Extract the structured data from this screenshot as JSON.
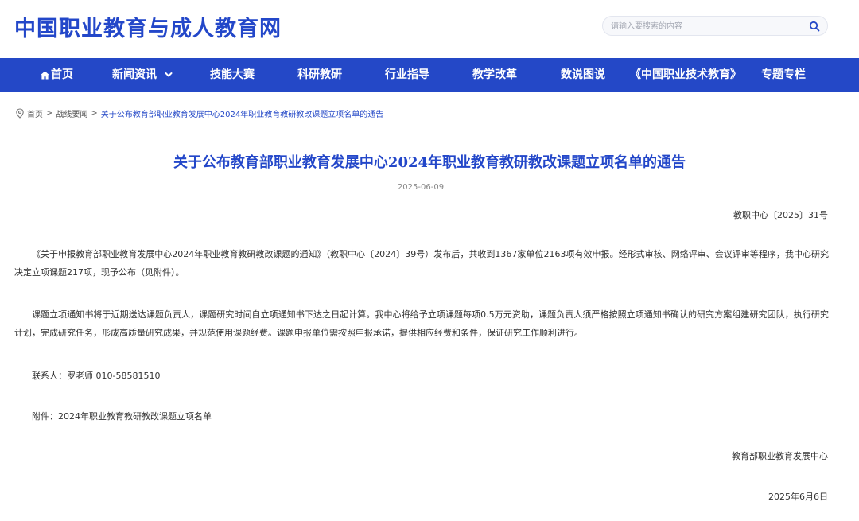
{
  "header": {
    "site_title": "中国职业教育与成人教育网",
    "search_placeholder": "请输入要搜索的内容"
  },
  "nav": {
    "items": [
      {
        "label": "首页",
        "icon": "home-icon"
      },
      {
        "label": "新闻资讯",
        "icon": "chevron-down-icon"
      },
      {
        "label": "技能大赛"
      },
      {
        "label": "科研教研"
      },
      {
        "label": "行业指导"
      },
      {
        "label": "教学改革"
      },
      {
        "label": "数说图说"
      },
      {
        "label": "《中国职业技术教育》"
      },
      {
        "label": "专题专栏"
      }
    ]
  },
  "breadcrumb": {
    "icon": "location-pin-icon",
    "items": [
      "首页",
      "战线要闻",
      "关于公布教育部职业教育发展中心2024年职业教育教研教改课题立项名单的通告"
    ],
    "separator": ">"
  },
  "article": {
    "title": "关于公布教育部职业教育发展中心2024年职业教育教研教改课题立项名单的通告",
    "date": "2025-06-09",
    "doc_no": "教职中心〔2025〕31号",
    "paragraphs": [
      "《关于申报教育部职业教育发展中心2024年职业教育教研教改课题的通知》（教职中心〔2024〕39号）发布后，共收到1367家单位2163项有效申报。经形式审核、网络评审、会议评审等程序，我中心研究决定立项课题217项，现予公布（见附件）。",
      "课题立项通知书将于近期送达课题负责人，课题研究时间自立项通知书下达之日起计算。我中心将给予立项课题每项0.5万元资助，课题负责人须严格按照立项通知书确认的研究方案组建研究团队，执行研究计划，完成研究任务，形成高质量研究成果，并规范使用课题经费。课题申报单位需按照申报承诺，提供相应经费和条件，保证研究工作顺利进行。",
      "联系人：罗老师 010-58581510",
      "附件：2024年职业教育教研教改课题立项名单"
    ],
    "signature_org": "教育部职业教育发展中心",
    "signature_date": "2025年6月6日"
  },
  "colors": {
    "brand_blue": "#2347c9",
    "nav_bg": "#2448c7"
  }
}
